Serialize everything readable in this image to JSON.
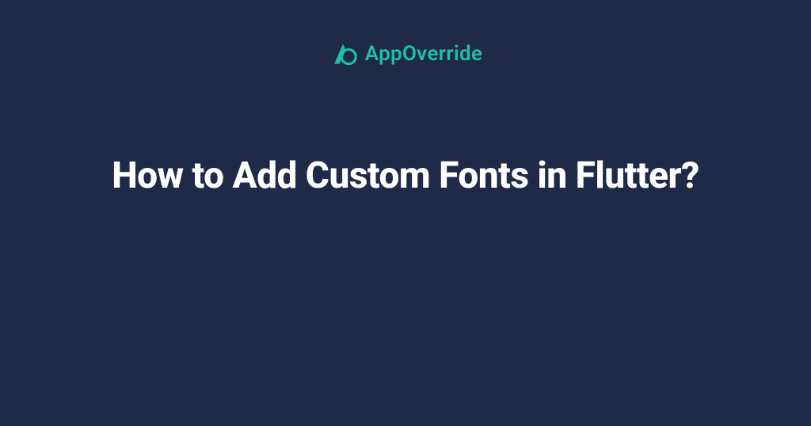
{
  "brand": {
    "name": "AppOverride",
    "accent_color": "#1fbfa6"
  },
  "headline": "How to Add Custom Fonts in Flutter?",
  "background_color": "#1e2a47"
}
